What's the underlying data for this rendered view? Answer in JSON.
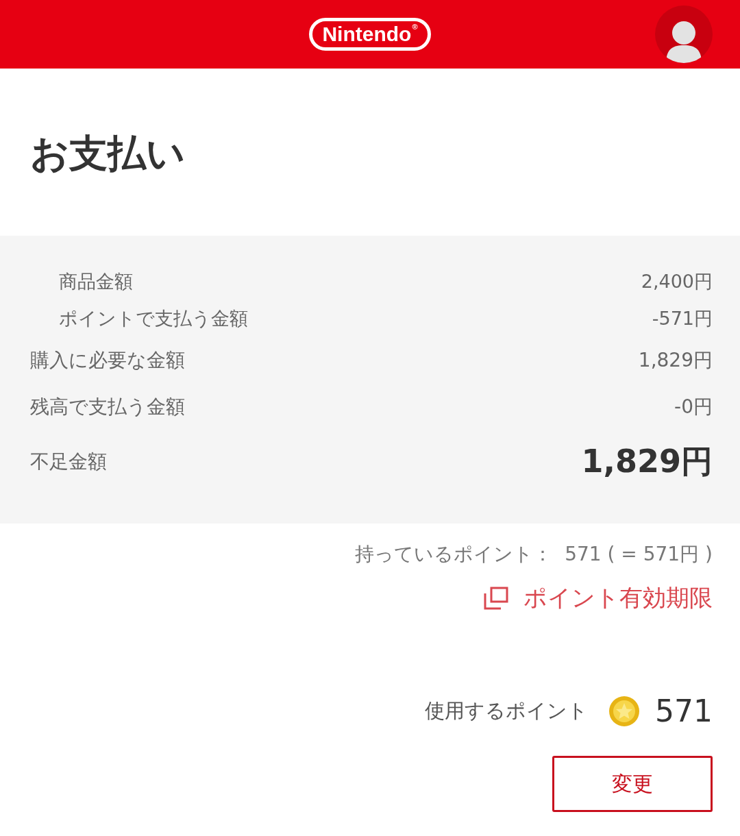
{
  "header": {
    "logo": "Nintendo",
    "logo_mark": "®"
  },
  "title": "お支払い",
  "summary": {
    "rows": [
      {
        "kind": "sub",
        "label": "商品金額",
        "value": "2,400円"
      },
      {
        "kind": "sub",
        "label": "ポイントで支払う金額",
        "value": "-571円"
      },
      {
        "kind": "main",
        "label": "購入に必要な金額",
        "value": "1,829円"
      },
      {
        "kind": "main",
        "label": "残高で支払う金額",
        "value": "-0円"
      },
      {
        "kind": "total",
        "label": "不足金額",
        "value": "1,829円"
      }
    ]
  },
  "points_held": "持っているポイント：  571 ( = 571円 )",
  "expiry_link": "ポイント有効期限",
  "use_points": {
    "label": "使用するポイント",
    "value": "571"
  },
  "change_button": "変更"
}
